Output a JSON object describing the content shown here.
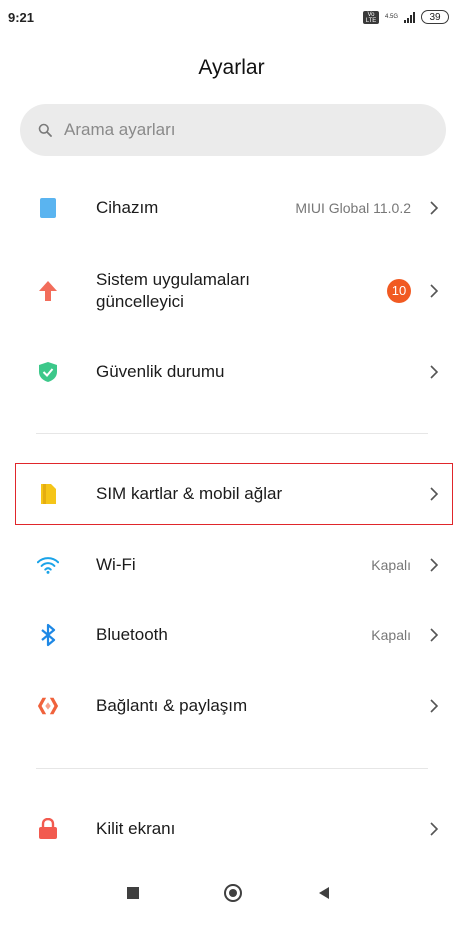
{
  "status_bar": {
    "time": "9:21",
    "network_type": "4.5G",
    "volte": "Vo LTE",
    "battery": "39"
  },
  "page_title": "Ayarlar",
  "search": {
    "placeholder": "Arama ayarları"
  },
  "items": [
    {
      "label": "Cihazım",
      "value": "MIUI Global 11.0.2",
      "icon": "phone-icon"
    },
    {
      "label": "Sistem uygulamaları güncelleyici",
      "badge": "10",
      "icon": "arrow-up-icon"
    },
    {
      "label": "Güvenlik durumu",
      "icon": "shield-check-icon"
    },
    {
      "label": "SIM kartlar & mobil ağlar",
      "icon": "sim-card-icon",
      "highlighted": true
    },
    {
      "label": "Wi-Fi",
      "value": "Kapalı",
      "icon": "wifi-icon"
    },
    {
      "label": "Bluetooth",
      "value": "Kapalı",
      "icon": "bluetooth-icon"
    },
    {
      "label": "Bağlantı & paylaşım",
      "icon": "connection-share-icon"
    },
    {
      "label": "Kilit ekranı",
      "icon": "lock-icon"
    }
  ],
  "colors": {
    "accent_highlight": "#e0262b",
    "badge": "#f15a22",
    "device_icon": "#5ab4f0",
    "update_icon": "#f26d5b",
    "security_icon": "#3cc88a",
    "sim_icon": "#f5c518",
    "wifi_icon": "#1aa3e8",
    "bluetooth_icon": "#1e88e5",
    "share_icon": "#f0623c",
    "lock_icon": "#f25a4f"
  }
}
